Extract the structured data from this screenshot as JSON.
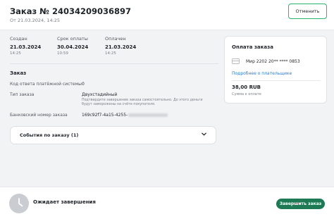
{
  "header": {
    "title": "Заказ № 24034209036897",
    "subtitle": "От 21.03.2024, 14:25",
    "cancel_label": "Отменить"
  },
  "dates": [
    {
      "label": "Создан",
      "date": "21.03.2024",
      "time": "14:25"
    },
    {
      "label": "Срок оплаты",
      "date": "30.04.2024",
      "time": "10:59"
    },
    {
      "label": "Оплачен",
      "date": "21.03.2024",
      "time": "14:25"
    }
  ],
  "order": {
    "section_title": "Заказ",
    "rows": [
      {
        "label": "Код ответа платёжной системы",
        "value": "0"
      },
      {
        "label": "Тип заказа",
        "value": "Двухстадийный",
        "note": "Подтвердите завершение заказа самостоятельно. До этого деньги будут заморожены на счёте покупателя."
      },
      {
        "label": "Банковский номер заказа",
        "value": "169c92f7-4a15-4255-"
      }
    ],
    "events_label": "События по заказу (1)"
  },
  "payment": {
    "title": "Оплата заказа",
    "card_number": "Мир 2202 20** **** 0853",
    "payer_link": "Подробнее о плательщике",
    "amount": "38,00 RUB",
    "amount_label": "Сумма к оплате"
  },
  "footer": {
    "status": "Ожидает завершения",
    "finish_label": "Завершить заказ"
  },
  "colors": {
    "accent_green": "#1e7a55",
    "outline_green": "#2fb36b",
    "link_blue": "#2a7bd4"
  }
}
